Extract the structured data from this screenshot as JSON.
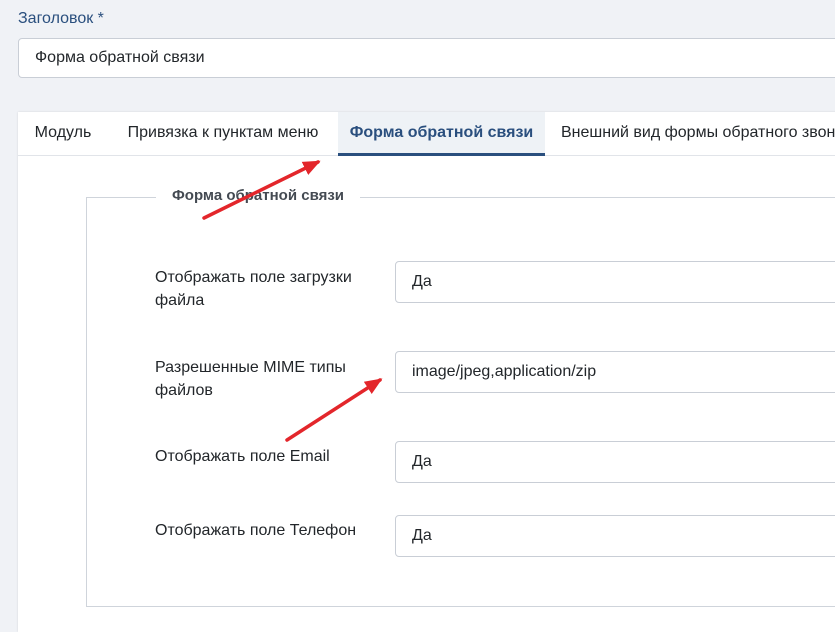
{
  "header": {
    "title_label": "Заголовок *",
    "title_value": "Форма обратной связи"
  },
  "tabs": [
    {
      "label": "Модуль",
      "active": false
    },
    {
      "label": "Привязка к пунктам меню",
      "active": false
    },
    {
      "label": "Форма обратной связи",
      "active": true
    },
    {
      "label": "Внешний вид формы обратного звонка",
      "active": false
    }
  ],
  "fieldset": {
    "legend": "Форма обратной связи",
    "fields": [
      {
        "label": "Отображать поле загрузки файла",
        "value": "Да"
      },
      {
        "label": "Разрешенные MIME типы файлов",
        "value": "image/jpeg,application/zip"
      },
      {
        "label": "Отображать поле Email",
        "value": "Да"
      },
      {
        "label": "Отображать поле Телефон",
        "value": "Да"
      }
    ]
  },
  "colors": {
    "accent": "#2a4f7e",
    "annotation_arrow": "#e3262b"
  }
}
